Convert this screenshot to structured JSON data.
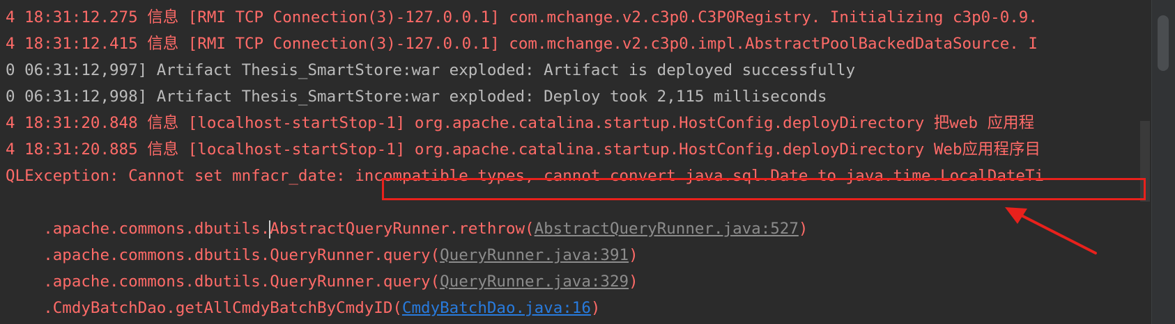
{
  "console": {
    "lines": [
      {
        "text": "4 18:31:12.275 信息 [RMI TCP Connection(3)-127.0.0.1] com.mchange.v2.c3p0.C3P0Registry. Initializing c3p0-0.9."
      },
      {
        "text": "4 18:31:12.415 信息 [RMI TCP Connection(3)-127.0.0.1] com.mchange.v2.c3p0.impl.AbstractPoolBackedDataSource. I"
      },
      {
        "text": "0 06:31:12,997] Artifact Thesis_SmartStore:war exploded: Artifact is deployed successfully"
      },
      {
        "text": "0 06:31:12,998] Artifact Thesis_SmartStore:war exploded: Deploy took 2,115 milliseconds"
      },
      {
        "text": "4 18:31:20.848 信息 [localhost-startStop-1] org.apache.catalina.startup.HostConfig.deployDirectory 把web 应用程"
      },
      {
        "text": "4 18:31:20.885 信息 [localhost-startStop-1] org.apache.catalina.startup.HostConfig.deployDirectory Web应用程序目"
      },
      {
        "text": "QLException: Cannot set mnfacr_date: incompatible types, cannot convert java.sql.Date to java.time.LocalDateTi"
      },
      {
        "prefix_a": ".apache.commons.dbutils.",
        "prefix_b": "AbstractQueryRunner.rethrow(",
        "link": "AbstractQueryRunner.java:527",
        "suffix": ")"
      },
      {
        "prefix": ".apache.commons.dbutils.QueryRunner.query(",
        "link": "QueryRunner.java:391",
        "suffix": ")"
      },
      {
        "prefix": ".apache.commons.dbutils.QueryRunner.query(",
        "link": "QueryRunner.java:329",
        "suffix": ")"
      },
      {
        "prefix": ".CmdyBatchDao.getAllCmdyBatchByCmdyID(",
        "link": "CmdyBatchDao.java:16",
        "suffix": ")"
      }
    ]
  },
  "colors": {
    "background": "#2b2b2b",
    "error_text": "#ff6b68",
    "info_text": "#bbbbbb",
    "link_gray": "#8c8c8c",
    "link_blue": "#287bde",
    "annotation_red": "#e8211c"
  }
}
